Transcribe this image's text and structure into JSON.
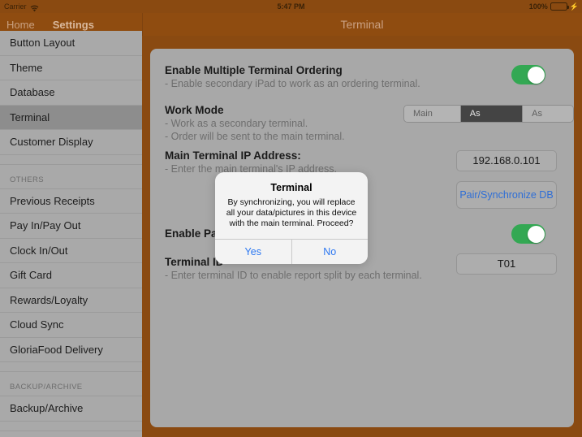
{
  "status_bar": {
    "carrier": "Carrier",
    "wifi_icon": "wifi-icon",
    "time": "5:47 PM",
    "battery_percent": "100%",
    "battery_icon": "battery-icon",
    "charging_icon": "lightning-bolt-icon"
  },
  "nav_bar": {
    "back_home": "Home",
    "back_settings": "Settings",
    "title": "Terminal"
  },
  "sidebar": {
    "items": [
      {
        "label": "Button Layout",
        "selected": false
      },
      {
        "label": "Theme",
        "selected": false
      },
      {
        "label": "Database",
        "selected": false
      },
      {
        "label": "Terminal",
        "selected": true
      },
      {
        "label": "Customer Display",
        "selected": false
      }
    ],
    "section_others": "OTHERS",
    "others_items": [
      {
        "label": "Previous Receipts"
      },
      {
        "label": "Pay In/Pay Out"
      },
      {
        "label": "Clock In/Out"
      },
      {
        "label": "Gift Card"
      },
      {
        "label": "Rewards/Loyalty"
      },
      {
        "label": "Cloud Sync"
      },
      {
        "label": "GloriaFood Delivery"
      }
    ],
    "section_backup": "BACKUP/ARCHIVE",
    "backup_items": [
      {
        "label": "Backup/Archive"
      }
    ]
  },
  "main": {
    "multi_terminal": {
      "title": "Enable Multiple Terminal Ordering",
      "desc": "- Enable secondary iPad to work as an ordering terminal.",
      "toggle_on": true
    },
    "work_mode": {
      "title": "Work Mode",
      "desc1": "- Work as a secondary terminal.",
      "desc2": "- Order will be sent to the main terminal.",
      "options": [
        "Main POS",
        "As Terminal",
        "As Kiosk"
      ],
      "selected": "As Terminal"
    },
    "main_ip": {
      "title": "Main Terminal IP Address:",
      "desc": "- Enter the main terminal's IP address.",
      "value": "192.168.0.101"
    },
    "pair_button": {
      "label": "Pair/Synchronize DB"
    },
    "enable_payment": {
      "title": "Enable Pay",
      "toggle_on": true
    },
    "terminal_id": {
      "title": "Terminal ID",
      "desc": "- Enter terminal ID to enable report split by each terminal.",
      "value": "T01"
    }
  },
  "dialog": {
    "title": "Terminal",
    "message": "By synchronizing, you will replace all your data/pictures in this device with the main terminal. Proceed?",
    "yes_label": "Yes",
    "no_label": "No"
  },
  "colors": {
    "brand_brown": "#8f4c10",
    "panel_gray": "#a8a8a8",
    "toggle_green": "#33a853",
    "link_blue": "#2d78f2",
    "segment_active": "#444444"
  }
}
